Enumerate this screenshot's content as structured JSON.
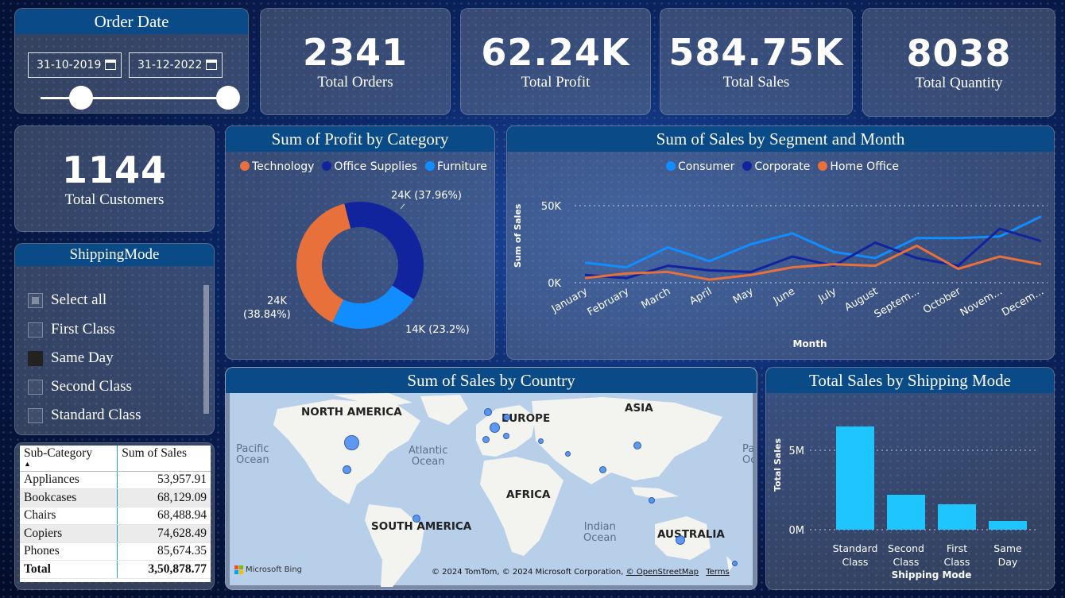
{
  "order_date": {
    "title": "Order Date",
    "start": "31-10-2019",
    "end": "31-12-2022"
  },
  "kpis": {
    "total_orders": {
      "value": "2341",
      "label": "Total Orders"
    },
    "total_profit": {
      "value": "62.24K",
      "label": "Total Profit"
    },
    "total_sales": {
      "value": "584.75K",
      "label": "Total Sales"
    },
    "total_quantity": {
      "value": "8038",
      "label": "Total Quantity"
    },
    "total_customers": {
      "value": "1144",
      "label": "Total Customers"
    }
  },
  "shipping_mode": {
    "title": "ShippingMode",
    "items": [
      {
        "label": "Select all",
        "state": "partial"
      },
      {
        "label": "First Class",
        "state": "unchecked"
      },
      {
        "label": "Same Day",
        "state": "checked"
      },
      {
        "label": "Second Class",
        "state": "unchecked"
      },
      {
        "label": "Standard Class",
        "state": "unchecked"
      }
    ]
  },
  "subcategory_table": {
    "headers": [
      "Sub-Category",
      "Sum of Sales"
    ],
    "rows": [
      {
        "name": "Appliances",
        "value": "53,957.91"
      },
      {
        "name": "Bookcases",
        "value": "68,129.09"
      },
      {
        "name": "Chairs",
        "value": "68,488.94"
      },
      {
        "name": "Copiers",
        "value": "74,628.49"
      },
      {
        "name": "Phones",
        "value": "85,674.35"
      }
    ],
    "total": {
      "name": "Total",
      "value": "3,50,878.77"
    }
  },
  "profit_by_category": {
    "title": "Sum of Profit by Category",
    "legend": [
      {
        "name": "Technology",
        "color": "#e8703a"
      },
      {
        "name": "Office Supplies",
        "color": "#12239e"
      },
      {
        "name": "Furniture",
        "color": "#118dff"
      }
    ],
    "labels": {
      "office": "24K (37.96%)",
      "tech_line1": "24K",
      "tech_line2": "(38.84%)",
      "furniture": "14K (23.2%)"
    }
  },
  "sales_segment_month": {
    "title": "Sum of Sales by Segment and Month",
    "legend": [
      {
        "name": "Consumer",
        "color": "#118dff"
      },
      {
        "name": "Corporate",
        "color": "#12239e"
      },
      {
        "name": "Home Office",
        "color": "#e8703a"
      }
    ],
    "ylabel": "Sum of Sales",
    "xlabel": "Month",
    "yticks": [
      "50K",
      "0K"
    ],
    "month_labels": [
      "January",
      "February",
      "March",
      "April",
      "May",
      "June",
      "July",
      "August",
      "Septem...",
      "October",
      "Novem...",
      "Decem..."
    ]
  },
  "sales_by_country": {
    "title": "Sum of Sales by Country",
    "continents": {
      "north_america": "NORTH AMERICA",
      "europe": "EUROPE",
      "asia": "ASIA",
      "africa": "AFRICA",
      "south_america": "SOUTH AMERICA",
      "australia": "AUSTRALIA"
    },
    "oceans": {
      "pacific_1": "Pacific",
      "pacific_2": "Ocean",
      "atlantic_1": "Atlantic",
      "atlantic_2": "Ocean",
      "indian_1": "Indian",
      "indian_2": "Ocean",
      "edge_1": "Pac",
      "edge_2": "Oce"
    },
    "attribution": "© 2024 TomTom, © 2024 Microsoft Corporation,",
    "osm_link": "© OpenStreetMap",
    "terms_link": "Terms",
    "bing": "Microsoft Bing"
  },
  "shipping_mode_sales": {
    "title": "Total Sales by Shipping Mode",
    "ylabel": "Total Sales",
    "xlabel": "Shipping Mode",
    "yticks": [
      "5M",
      "0M"
    ],
    "cat_lines": [
      [
        "Standard",
        "Class"
      ],
      [
        "Second",
        "Class"
      ],
      [
        "First",
        "Class"
      ],
      [
        "Same",
        "Day"
      ]
    ]
  },
  "chart_data": [
    {
      "type": "pie",
      "title": "Sum of Profit by Category",
      "categories": [
        "Technology",
        "Office Supplies",
        "Furniture"
      ],
      "values": [
        24000,
        24000,
        14000
      ],
      "percent": [
        38.84,
        37.96,
        23.2
      ]
    },
    {
      "type": "line",
      "title": "Sum of Sales by Segment and Month",
      "xlabel": "Month",
      "ylabel": "Sum of Sales",
      "categories": [
        "January",
        "February",
        "March",
        "April",
        "May",
        "June",
        "July",
        "August",
        "September",
        "October",
        "November",
        "December"
      ],
      "ylim": [
        0,
        50000
      ],
      "series": [
        {
          "name": "Consumer",
          "color": "#118dff",
          "values": [
            13000,
            10000,
            23000,
            14000,
            25000,
            32000,
            20000,
            16000,
            29000,
            29000,
            30000,
            43000
          ]
        },
        {
          "name": "Corporate",
          "color": "#12239e",
          "values": [
            5000,
            3000,
            11000,
            8000,
            7000,
            17000,
            11000,
            26000,
            16000,
            11000,
            35000,
            27000
          ]
        },
        {
          "name": "Home Office",
          "color": "#e8703a",
          "values": [
            3000,
            6000,
            7000,
            2000,
            5000,
            10000,
            12000,
            11000,
            24000,
            9000,
            17000,
            12000
          ]
        }
      ]
    },
    {
      "type": "bar",
      "title": "Total Sales by Shipping Mode",
      "xlabel": "Shipping Mode",
      "ylabel": "Total Sales",
      "categories": [
        "Standard Class",
        "Second Class",
        "First Class",
        "Same Day"
      ],
      "values": [
        6500000,
        2200000,
        1600000,
        550000
      ],
      "ylim": [
        0,
        7000000
      ],
      "color": "#1ec5ff"
    }
  ]
}
